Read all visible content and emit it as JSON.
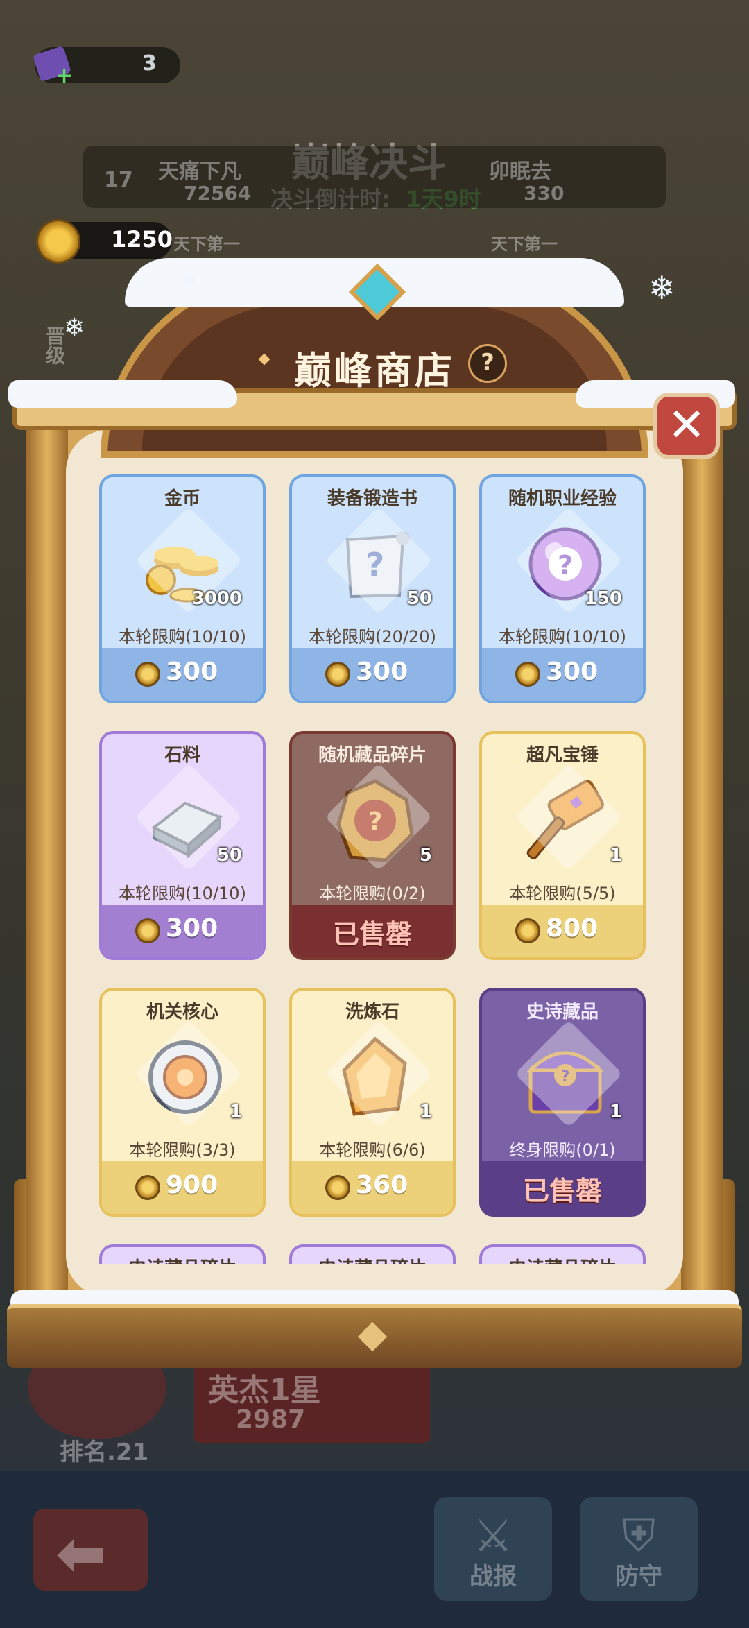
{
  "background": {
    "ticket_count": "3",
    "trophy_value": "1250",
    "event_title": "巅峰决斗",
    "countdown_label": "决斗倒计时:",
    "countdown_value": "1天9时",
    "left_player_rank": "17",
    "left_player_name": "天痛下凡",
    "left_player_score": "72564",
    "right_player_name": "卯眠去",
    "right_player_score": "330",
    "left_badge": "天下第一",
    "right_badge": "天下第一",
    "side_tab": "晋级",
    "my_title": "英杰1星",
    "my_score": "2987",
    "my_rank": "排名.21",
    "battle_report_label": "战报",
    "defense_label": "防守"
  },
  "shop": {
    "title": "巅峰商店",
    "help_symbol": "?",
    "close_symbol": "✕",
    "items": [
      {
        "name": "金币",
        "qty": "3000",
        "limit": "本轮限购(10/10)",
        "price": "300",
        "sold_out": false,
        "theme": "blue",
        "icon": "gold-coins-icon"
      },
      {
        "name": "装备锻造书",
        "qty": "50",
        "limit": "本轮限购(20/20)",
        "price": "300",
        "sold_out": false,
        "theme": "blue",
        "icon": "forge-scroll-icon"
      },
      {
        "name": "随机职业经验",
        "qty": "150",
        "limit": "本轮限购(10/10)",
        "price": "300",
        "sold_out": false,
        "theme": "blue",
        "icon": "exp-orb-icon"
      },
      {
        "name": "石料",
        "qty": "50",
        "limit": "本轮限购(10/10)",
        "price": "300",
        "sold_out": false,
        "theme": "purple",
        "icon": "stone-ingot-icon"
      },
      {
        "name": "随机藏品碎片",
        "qty": "5",
        "limit": "本轮限购(0/2)",
        "price": "已售罄",
        "sold_out": true,
        "theme": "brown",
        "icon": "collectible-fragment-icon"
      },
      {
        "name": "超凡宝锤",
        "qty": "1",
        "limit": "本轮限购(5/5)",
        "price": "800",
        "sold_out": false,
        "theme": "gold",
        "icon": "hammer-icon"
      },
      {
        "name": "机关核心",
        "qty": "1",
        "limit": "本轮限购(3/3)",
        "price": "900",
        "sold_out": false,
        "theme": "gold",
        "icon": "mechanism-core-icon"
      },
      {
        "name": "洗炼石",
        "qty": "1",
        "limit": "本轮限购(6/6)",
        "price": "360",
        "sold_out": false,
        "theme": "gold",
        "icon": "refine-stone-icon"
      },
      {
        "name": "史诗藏品",
        "qty": "1",
        "limit": "终身限购(0/1)",
        "price": "已售罄",
        "sold_out": true,
        "theme": "violet",
        "icon": "epic-chest-icon"
      },
      {
        "name": "史诗藏品碎片",
        "theme": "purple",
        "partial": true
      },
      {
        "name": "史诗藏品碎片",
        "theme": "purple",
        "partial": true
      },
      {
        "name": "史诗藏品碎片",
        "theme": "purple",
        "partial": true
      }
    ]
  }
}
